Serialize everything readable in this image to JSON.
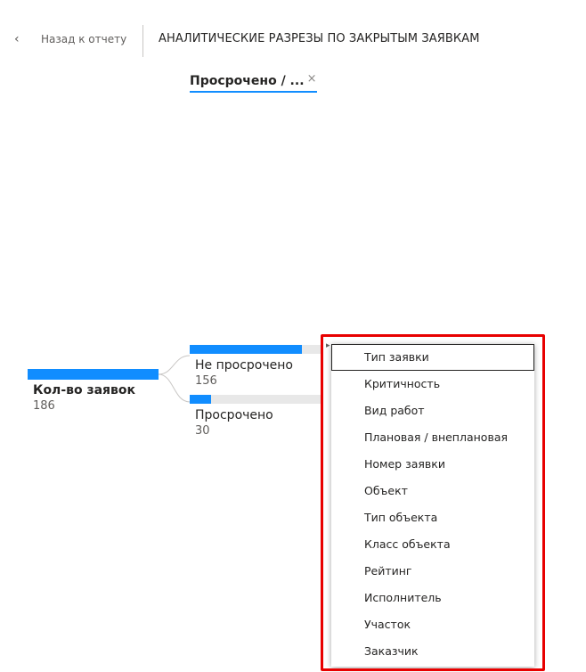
{
  "header": {
    "back_label": "Назад к отчету",
    "title": "АНАЛИТИЧЕСКИЕ РАЗРЕЗЫ ПО ЗАКРЫТЫМ ЗАЯВКАМ"
  },
  "filter": {
    "label": "Просрочено / ...",
    "close_glyph": "×"
  },
  "tree": {
    "root": {
      "label": "Кол-во заявок",
      "value": "186"
    },
    "children": [
      {
        "label": "Не просрочено",
        "value": "156",
        "fill_fraction": 0.84
      },
      {
        "label": "Просрочено",
        "value": "30",
        "fill_fraction": 0.16
      }
    ]
  },
  "dropdown": {
    "selected_index": 0,
    "items": [
      "Тип заявки",
      "Критичность",
      "Вид работ",
      "Плановая / внеплановая",
      "Номер заявки",
      "Объект",
      "Тип объекта",
      "Класс объекта",
      "Рейтинг",
      "Исполнитель",
      "Участок",
      "Заказчик"
    ]
  },
  "colors": {
    "accent": "#118dff",
    "highlight": "#e80000"
  }
}
